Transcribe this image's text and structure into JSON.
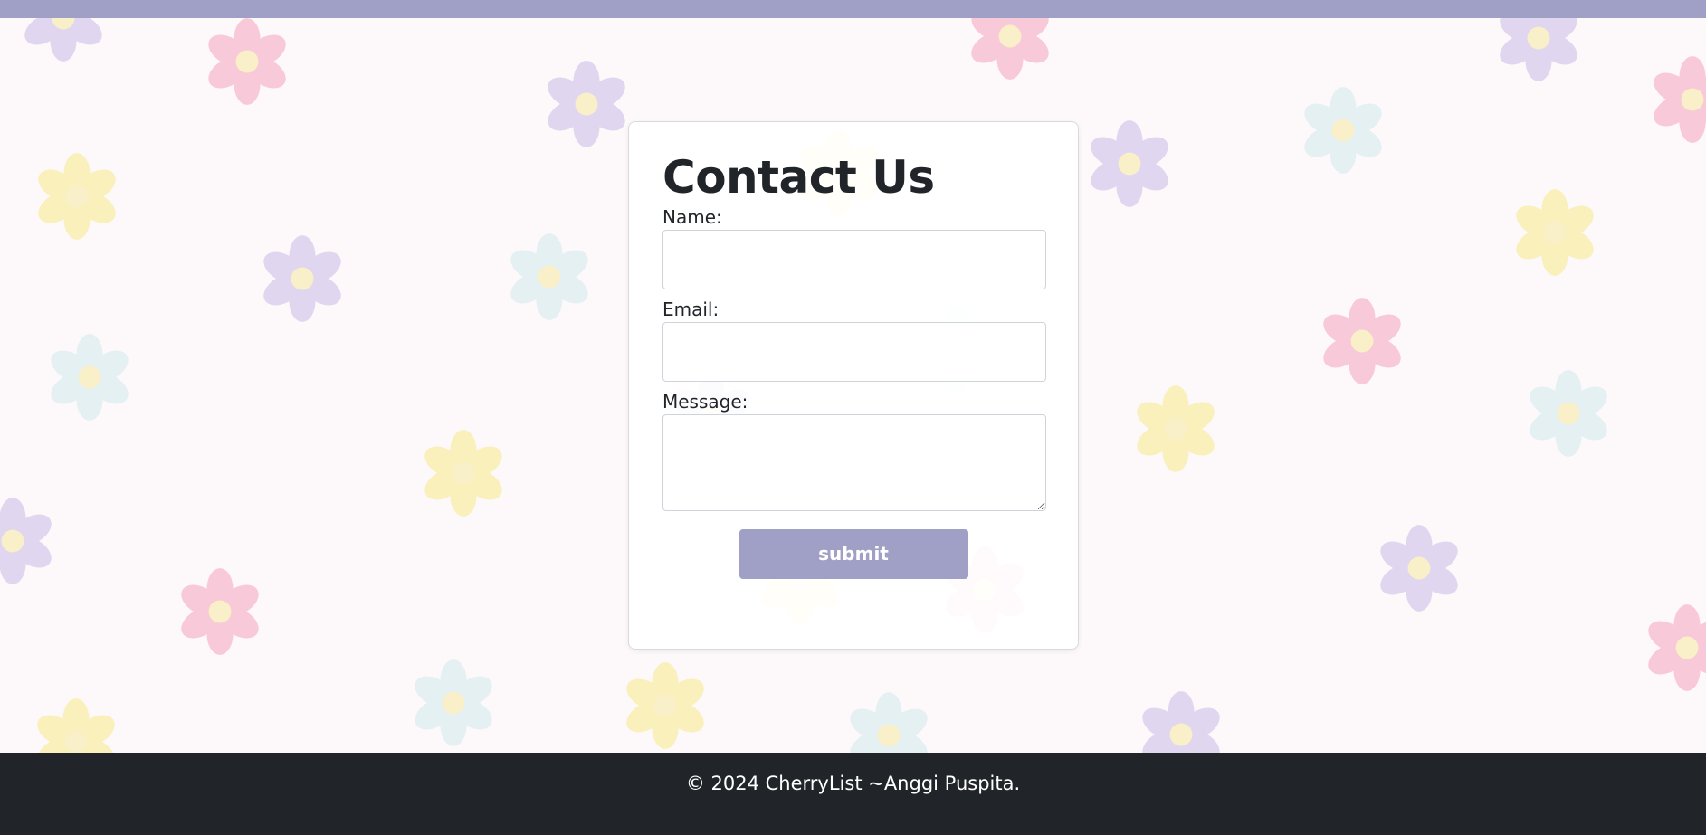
{
  "page": {
    "background_color": "#fdf9fa",
    "accent_color": "#a09fc6"
  },
  "background": {
    "pattern": "flower-pattern",
    "flower_colors": {
      "pink": "#f5a3bd",
      "purple": "#cbbbe8",
      "blue": "#d3e9ef",
      "yellow": "#f6e98a",
      "center": "#f6e7a0"
    }
  },
  "contact": {
    "title": "Contact Us",
    "name_label": "Name:",
    "name_value": "",
    "email_label": "Email:",
    "email_value": "",
    "message_label": "Message:",
    "message_value": "",
    "submit_label": "submit"
  },
  "footer": {
    "text": "© 2024 CherryList ~Anggi Puspita.",
    "background_color": "#212529"
  }
}
